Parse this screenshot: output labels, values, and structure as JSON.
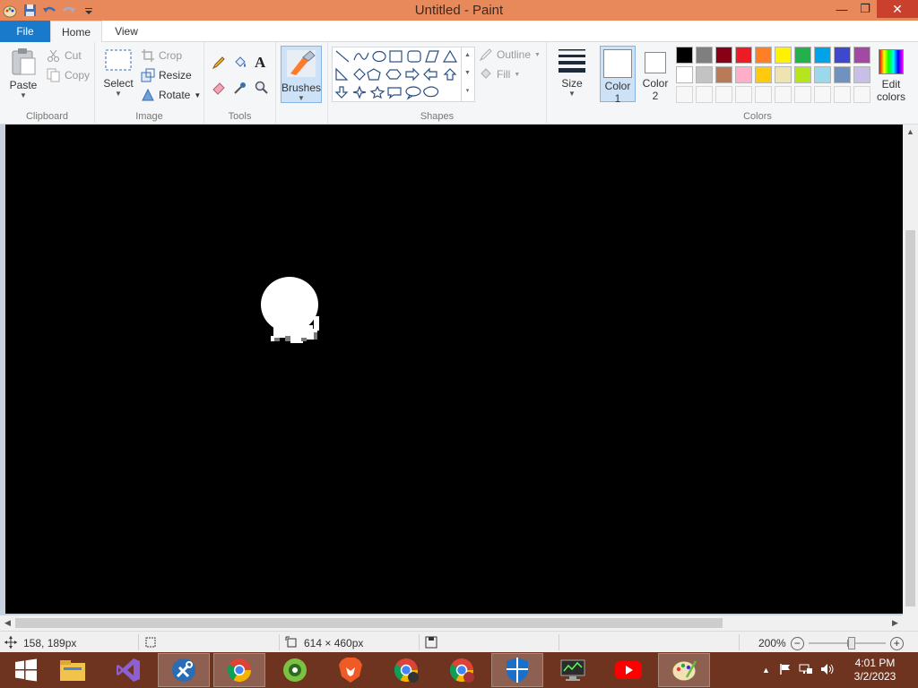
{
  "window": {
    "title": "Untitled - Paint",
    "close": "✕",
    "maximize": "❐",
    "minimize": "—"
  },
  "tabs": [
    {
      "label": "File"
    },
    {
      "label": "Home"
    },
    {
      "label": "View"
    }
  ],
  "clipboard": {
    "group": "Clipboard",
    "paste": "Paste",
    "cut": "Cut",
    "copy": "Copy"
  },
  "image": {
    "group": "Image",
    "select": "Select",
    "crop": "Crop",
    "resize": "Resize",
    "rotate": "Rotate"
  },
  "tools": {
    "group": "Tools",
    "text_glyph": "A"
  },
  "brushes": {
    "label": "Brushes"
  },
  "shapes": {
    "group": "Shapes",
    "outline": "Outline",
    "fill": "Fill"
  },
  "size": {
    "label": "Size"
  },
  "colors": {
    "group": "Colors",
    "color1_line1": "Color",
    "color1_line2": "1",
    "color2_line1": "Color",
    "color2_line2": "2",
    "edit_line1": "Edit",
    "edit_line2": "colors",
    "color1": "#ffffff",
    "color2": "#ffffff",
    "palette_row1": [
      "#000000",
      "#7f7f7f",
      "#880015",
      "#ed1c24",
      "#ff7f27",
      "#fff200",
      "#22b14c",
      "#00a2e8",
      "#3f48cc",
      "#a349a4"
    ],
    "palette_row2": [
      "#ffffff",
      "#c3c3c3",
      "#b97a57",
      "#ffaec9",
      "#ffc90e",
      "#efe4b0",
      "#b5e61d",
      "#99d9ea",
      "#7092be",
      "#c8bfe7"
    ]
  },
  "canvas": {
    "background": "#000000",
    "blob_color": "#ffffff"
  },
  "status": {
    "cursor_pos": "158, 189px",
    "canvas_size": "614 × 460px",
    "zoom": "200%"
  },
  "taskbar": {
    "apps": [
      "windows-start",
      "file-explorer",
      "visual-studio",
      "setup-tool",
      "chrome",
      "camtasia",
      "brave",
      "chrome-profile-b",
      "chrome-profile-c",
      "windows-defender",
      "system-monitor",
      "youtube",
      "paint"
    ],
    "time": "4:01 PM",
    "date": "3/2/2023"
  }
}
